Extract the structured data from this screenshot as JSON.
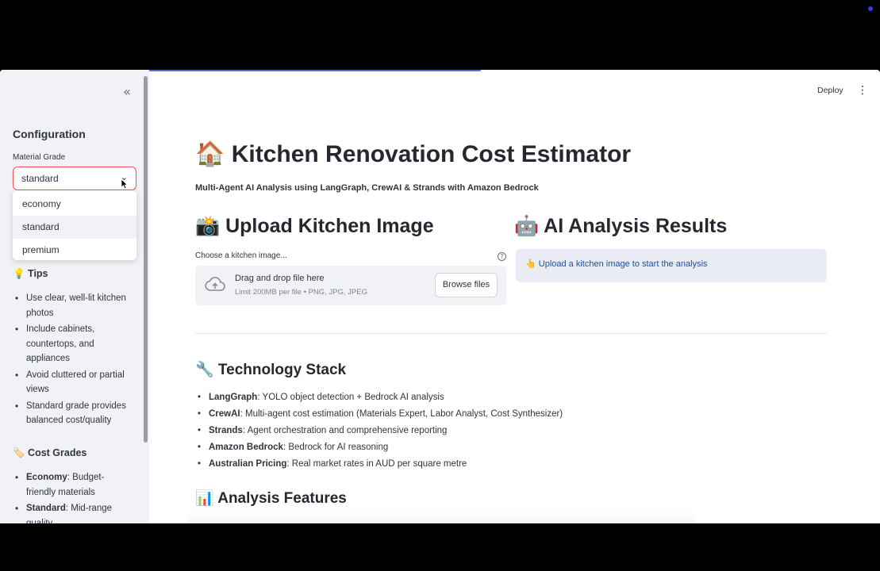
{
  "sidebar": {
    "title": "Configuration",
    "material_grade_label": "Material Grade",
    "selected_value": "standard",
    "options": [
      "economy",
      "standard",
      "premium"
    ],
    "tips_heading": "💡 Tips",
    "tips": [
      "Use clear, well-lit kitchen photos",
      "Include cabinets, countertops, and appliances",
      "Avoid cluttered or partial views",
      "Standard grade provides balanced cost/quality"
    ],
    "cost_grades_heading": "🏷️ Cost Grades",
    "cost_grades": [
      {
        "name": "Economy",
        "desc": ": Budget-friendly materials"
      },
      {
        "name": "Standard",
        "desc": ": Mid-range quality"
      }
    ]
  },
  "header": {
    "deploy_label": "Deploy"
  },
  "main": {
    "title": "🏠 Kitchen Renovation Cost Estimator",
    "subtitle": "Multi-Agent AI Analysis using LangGraph, CrewAI & Strands with Amazon Bedrock",
    "upload_heading": "📸 Upload Kitchen Image",
    "results_heading": "🤖 AI Analysis Results",
    "choose_label": "Choose a kitchen image...",
    "dropzone_title": "Drag and drop file here",
    "dropzone_limit": "Limit 200MB per file • PNG, JPG, JPEG",
    "browse_label": "Browse files",
    "info_text": "👆 Upload a kitchen image to start the analysis",
    "tech_heading": "🔧 Technology Stack",
    "tech_items": [
      {
        "name": "LangGraph",
        "desc": ": YOLO object detection + Bedrock AI analysis"
      },
      {
        "name": "CrewAI",
        "desc": ": Multi-agent cost estimation (Materials Expert, Labor Analyst, Cost Synthesizer)"
      },
      {
        "name": "Strands",
        "desc": ": Agent orchestration and comprehensive reporting"
      },
      {
        "name": "Amazon Bedrock",
        "desc": ": Bedrock for AI reasoning"
      },
      {
        "name": "Australian Pricing",
        "desc": ": Real market rates in AUD per square metre"
      }
    ],
    "features_heading": "📊 Analysis Features"
  },
  "colors": {
    "accent": "#ff4b4b",
    "sidebar_bg": "#f0f2f6",
    "info_bg": "#e9edf3",
    "info_text": "#1f4e9e"
  }
}
